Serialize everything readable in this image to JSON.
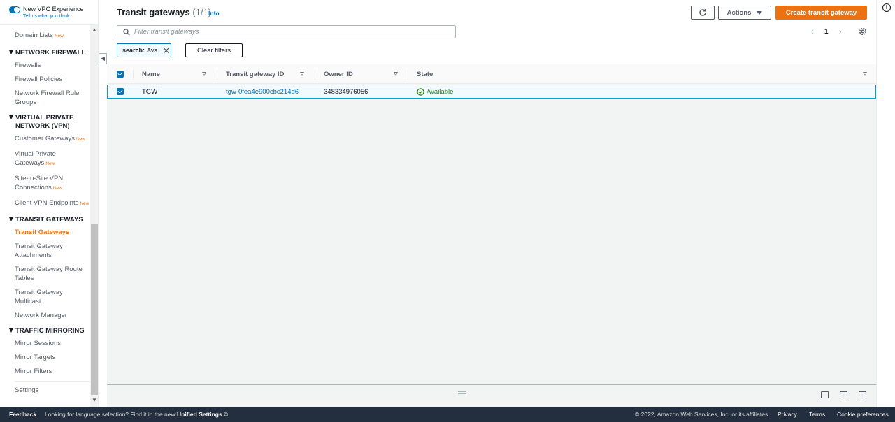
{
  "sidebar": {
    "vpc_experience_label": "New VPC Experience",
    "vpc_experience_link": "Tell us what you think",
    "new_badge": "New",
    "domain_lists": "Domain Lists",
    "sections": {
      "network_firewall": "NETWORK FIREWALL",
      "vpn": "VIRTUAL PRIVATE NETWORK (VPN)",
      "transit_gateways": "TRANSIT GATEWAYS",
      "traffic_mirroring": "TRAFFIC MIRRORING"
    },
    "firewall_items": [
      "Firewalls",
      "Firewall Policies",
      "Network Firewall Rule Groups"
    ],
    "vpn_items": [
      "Customer Gateways",
      "Virtual Private Gateways",
      "Site-to-Site VPN Connections",
      "Client VPN Endpoints"
    ],
    "tgw_items": [
      "Transit Gateways",
      "Transit Gateway Attachments",
      "Transit Gateway Route Tables",
      "Transit Gateway Multicast",
      "Network Manager"
    ],
    "mirror_items": [
      "Mirror Sessions",
      "Mirror Targets",
      "Mirror Filters"
    ],
    "settings": "Settings"
  },
  "header": {
    "title": "Transit gateways",
    "count": "(1/1)",
    "info": "Info",
    "actions_label": "Actions",
    "create_label": "Create transit gateway"
  },
  "search": {
    "placeholder": "Filter transit gateways",
    "token_key": "search:",
    "token_value": "Ava",
    "clear_label": "Clear filters"
  },
  "pagination": {
    "page": "1"
  },
  "table": {
    "columns": [
      "Name",
      "Transit gateway ID",
      "Owner ID",
      "State"
    ],
    "rows": [
      {
        "name": "TGW",
        "id": "tgw-0fea4e900cbc214d6",
        "owner": "348334976056",
        "state": "Available",
        "selected": true
      }
    ]
  },
  "footer": {
    "feedback": "Feedback",
    "language_text": "Looking for language selection? Find it in the new",
    "unified_settings": "Unified Settings",
    "copyright": "© 2022, Amazon Web Services, Inc. or its affiliates.",
    "privacy": "Privacy",
    "terms": "Terms",
    "cookie": "Cookie preferences"
  },
  "colors": {
    "accent": "#0073bb",
    "brand_orange": "#ec7211",
    "status_ok": "#1d8102",
    "footer_bg": "#232f3e"
  }
}
